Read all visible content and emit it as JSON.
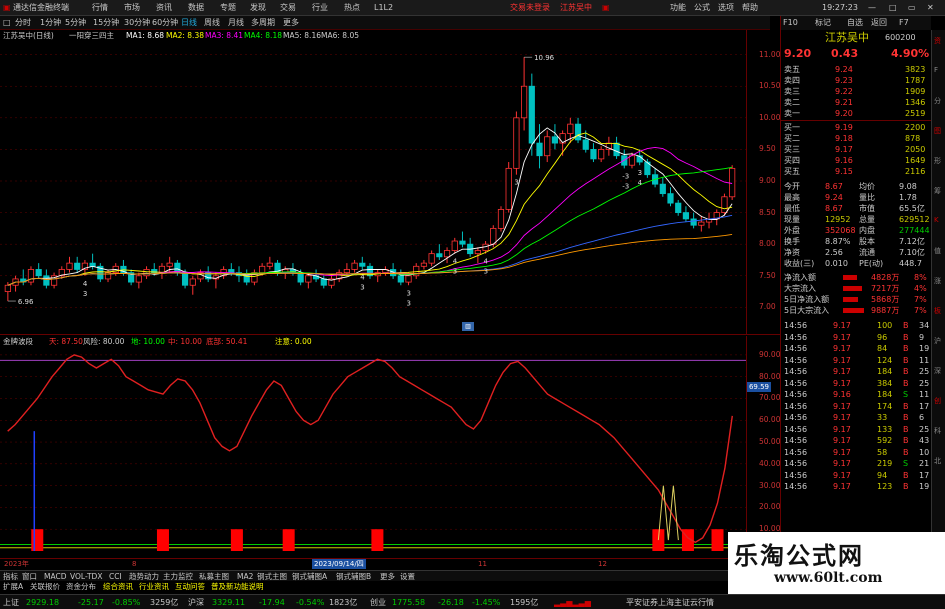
{
  "titlebar": {
    "app_title": "通达信金融终端",
    "menu": [
      "行情",
      "市场",
      "资讯",
      "数据",
      "专题",
      "发现",
      "交易",
      "行业",
      "热点",
      "L1L2"
    ],
    "login_status": "交易未登录",
    "stock_title": "江苏吴中",
    "right": [
      "功能",
      "公式",
      "选项",
      "帮助"
    ],
    "clock": "19:27:23"
  },
  "periods": [
    "分时",
    "1分钟",
    "5分钟",
    "15分钟",
    "30分钟",
    "60分钟",
    "日线",
    "周线",
    "月线",
    "多周期",
    "更多"
  ],
  "mainchart": {
    "stock_label": "江苏吴中(日线)",
    "pattern_label": "一阳穿三四主",
    "ma": [
      "MA1: 8.68",
      "MA2: 8.38",
      "MA3: 8.41",
      "MA4: 8.18",
      "MA5: 8.16",
      "MA6: 8.05"
    ],
    "high_label": "10.96",
    "low_label": "6.96",
    "markers": [
      "4",
      "3",
      "4",
      "3",
      "3",
      "3",
      "4",
      "3",
      "4",
      "3",
      "3",
      "-3",
      "-3",
      "4",
      "3"
    ]
  },
  "axis_main": [
    "11.00",
    "10.50",
    "10.00",
    "9.50",
    "9.00",
    "8.50",
    "8.00",
    "7.50",
    "7.00"
  ],
  "axis_sub": [
    "90.00",
    "80.00",
    "70.00",
    "60.00",
    "50.00",
    "40.00",
    "30.00",
    "20.00",
    "10.00"
  ],
  "subchart": {
    "name": "金牌波段",
    "legend": [
      "天: 87.50",
      "风险: 80.00",
      "地: 10.00",
      "中: 10.00",
      "底部: 50.41",
      "注意: 0.00"
    ],
    "cursor_value": "69.59"
  },
  "dateaxis": [
    "2023年",
    "8",
    "2023/09/14/四",
    "11",
    "12"
  ],
  "tabs": [
    "指标",
    "窗口",
    "MACD",
    "VOL-TDX",
    "CCI",
    "趋势动力",
    "主力监控",
    "私募主图",
    "MA2",
    "钢式主图",
    "钢式辅图A",
    "钢式辅图B",
    "更多",
    "设置"
  ],
  "tabs2": [
    "扩展A",
    "关联报价",
    "资金分布",
    "综合资讯",
    "行业资讯",
    "互动问答",
    "普及新功能说明"
  ],
  "status": {
    "sh": {
      "name": "上证",
      "value": "2929.18",
      "change": "-25.17",
      "pct": "-0.85%",
      "turnover": "3259亿"
    },
    "sz": {
      "name": "沪深",
      "value": "3329.11",
      "change": "-17.94",
      "pct": "-0.54%",
      "turnover": "1823亿"
    },
    "cy": {
      "name": "创业",
      "value": "1775.58",
      "change": "-26.18",
      "pct": "-1.45%",
      "turnover": "1595亿"
    },
    "server": "平安证券上海主证云行情"
  },
  "rp": {
    "toolbar": [
      "F10",
      "标记",
      "自选",
      "返回",
      "F7"
    ],
    "stock_name": "江苏吴中",
    "stock_code": "600200",
    "price": "9.20",
    "change": "0.43",
    "pct": "4.90%",
    "sells": [
      {
        "label": "卖五",
        "price": "9.24",
        "vol": "3823"
      },
      {
        "label": "卖四",
        "price": "9.23",
        "vol": "1787"
      },
      {
        "label": "卖三",
        "price": "9.22",
        "vol": "1909"
      },
      {
        "label": "卖二",
        "price": "9.21",
        "vol": "1346"
      },
      {
        "label": "卖一",
        "price": "9.20",
        "vol": "2519"
      }
    ],
    "buys": [
      {
        "label": "买一",
        "price": "9.19",
        "vol": "2200"
      },
      {
        "label": "买二",
        "price": "9.18",
        "vol": "878"
      },
      {
        "label": "买三",
        "price": "9.17",
        "vol": "2050"
      },
      {
        "label": "买四",
        "price": "9.16",
        "vol": "1649"
      },
      {
        "label": "买五",
        "price": "9.15",
        "vol": "2116"
      }
    ],
    "stats": [
      {
        "l1": "今开",
        "v1": "8.67",
        "l2": "均价",
        "v2": "9.08"
      },
      {
        "l1": "最高",
        "v1": "9.24",
        "l2": "量比",
        "v2": "1.78"
      },
      {
        "l1": "最低",
        "v1": "8.67",
        "l2": "市值",
        "v2": "65.5亿"
      },
      {
        "l1": "现量",
        "v1": "12952",
        "l2": "总量",
        "v2": "629512"
      },
      {
        "l1": "外盘",
        "v1": "352068",
        "l2": "内盘",
        "v2": "277444"
      },
      {
        "l1": "换手",
        "v1": "8.87%",
        "l2": "股本",
        "v2": "7.12亿"
      },
      {
        "l1": "净资",
        "v1": "2.56",
        "l2": "流通",
        "v2": "7.10亿"
      },
      {
        "l1": "收益(三)",
        "v1": "0.010",
        "l2": "PE(动)",
        "v2": "448.7"
      }
    ],
    "flows": [
      {
        "label": "净流入额",
        "value": "4828万",
        "pct": "8%",
        "level": 0.62
      },
      {
        "label": "大宗流入",
        "value": "7217万",
        "pct": "4%",
        "level": 0.88
      },
      {
        "label": "5日净流入额",
        "value": "5868万",
        "pct": "7%",
        "level": 0.7
      },
      {
        "label": "5日大宗流入",
        "value": "9887万",
        "pct": "7%",
        "level": 0.95
      }
    ],
    "ticks": [
      [
        "14:56",
        "9.17",
        "100",
        "B",
        "34"
      ],
      [
        "14:56",
        "9.17",
        "96",
        "B",
        "9"
      ],
      [
        "14:56",
        "9.17",
        "84",
        "B",
        "19"
      ],
      [
        "14:56",
        "9.17",
        "124",
        "B",
        "11"
      ],
      [
        "14:56",
        "9.17",
        "184",
        "B",
        "25"
      ],
      [
        "14:56",
        "9.17",
        "384",
        "B",
        "25"
      ],
      [
        "14:56",
        "9.16",
        "184",
        "S",
        "11"
      ],
      [
        "14:56",
        "9.17",
        "174",
        "B",
        "17"
      ],
      [
        "14:56",
        "9.17",
        "33",
        "B",
        "6"
      ],
      [
        "14:56",
        "9.17",
        "133",
        "B",
        "25"
      ],
      [
        "14:56",
        "9.17",
        "592",
        "B",
        "43"
      ],
      [
        "14:56",
        "9.17",
        "58",
        "B",
        "10"
      ],
      [
        "14:56",
        "9.17",
        "219",
        "S",
        "21"
      ],
      [
        "14:56",
        "9.17",
        "94",
        "B",
        "17"
      ],
      [
        "14:56",
        "9.17",
        "123",
        "B",
        "19"
      ]
    ]
  },
  "sidebar": [
    "资",
    "F",
    "分",
    "图",
    "形",
    "筹",
    "K",
    "值",
    "涨",
    "板",
    "沪",
    "深",
    "创",
    "科",
    "北"
  ],
  "watermark": {
    "title": "乐淘公式网",
    "url": "www.60lt.com"
  },
  "colors": {
    "up": "#ff3333",
    "down": "#00c0c0",
    "ma1": "#ffffff",
    "ma2": "#ffff00",
    "ma3": "#ff00ff",
    "ma4": "#00ff00",
    "ma5": "#3366ff",
    "ma6": "#ff9900",
    "indicator": "#e02020",
    "grid": "#660000"
  },
  "chart_data": [
    {
      "type": "candlestick",
      "ylim": [
        6.8,
        11.2
      ],
      "ylabel": "",
      "xlabel": "",
      "ohlc": [
        [
          7.25,
          7.4,
          7.1,
          7.35
        ],
        [
          7.35,
          7.5,
          7.25,
          7.45
        ],
        [
          7.45,
          7.6,
          7.35,
          7.4
        ],
        [
          7.4,
          7.65,
          7.35,
          7.6
        ],
        [
          7.6,
          7.7,
          7.45,
          7.5
        ],
        [
          7.5,
          7.6,
          7.3,
          7.35
        ],
        [
          7.35,
          7.55,
          7.3,
          7.5
        ],
        [
          7.5,
          7.65,
          7.45,
          7.6
        ],
        [
          7.6,
          7.8,
          7.55,
          7.7
        ],
        [
          7.7,
          7.8,
          7.55,
          7.6
        ],
        [
          7.6,
          7.75,
          7.5,
          7.7
        ],
        [
          7.7,
          7.85,
          7.6,
          7.65
        ],
        [
          7.65,
          7.7,
          7.4,
          7.45
        ],
        [
          7.45,
          7.6,
          7.4,
          7.55
        ],
        [
          7.55,
          7.7,
          7.5,
          7.65
        ],
        [
          7.65,
          7.75,
          7.5,
          7.55
        ],
        [
          7.55,
          7.6,
          7.35,
          7.4
        ],
        [
          7.4,
          7.55,
          7.3,
          7.5
        ],
        [
          7.5,
          7.65,
          7.45,
          7.6
        ],
        [
          7.6,
          7.7,
          7.5,
          7.55
        ],
        [
          7.55,
          7.7,
          7.45,
          7.65
        ],
        [
          7.65,
          7.8,
          7.55,
          7.7
        ],
        [
          7.7,
          7.75,
          7.5,
          7.55
        ],
        [
          7.55,
          7.6,
          7.3,
          7.35
        ],
        [
          7.35,
          7.5,
          7.2,
          7.45
        ],
        [
          7.45,
          7.6,
          7.4,
          7.55
        ],
        [
          7.55,
          7.65,
          7.4,
          7.45
        ],
        [
          7.45,
          7.55,
          7.3,
          7.5
        ],
        [
          7.5,
          7.65,
          7.45,
          7.6
        ],
        [
          7.6,
          7.7,
          7.5,
          7.55
        ],
        [
          7.55,
          7.65,
          7.4,
          7.5
        ],
        [
          7.5,
          7.6,
          7.35,
          7.4
        ],
        [
          7.4,
          7.6,
          7.35,
          7.55
        ],
        [
          7.55,
          7.7,
          7.5,
          7.65
        ],
        [
          7.65,
          7.8,
          7.6,
          7.7
        ],
        [
          7.7,
          7.75,
          7.5,
          7.55
        ],
        [
          7.55,
          7.65,
          7.45,
          7.6
        ],
        [
          7.6,
          7.7,
          7.5,
          7.55
        ],
        [
          7.55,
          7.6,
          7.35,
          7.4
        ],
        [
          7.4,
          7.55,
          7.3,
          7.5
        ],
        [
          7.5,
          7.6,
          7.4,
          7.45
        ],
        [
          7.45,
          7.5,
          7.3,
          7.35
        ],
        [
          7.35,
          7.5,
          7.3,
          7.45
        ],
        [
          7.45,
          7.6,
          7.4,
          7.55
        ],
        [
          7.55,
          7.7,
          7.5,
          7.6
        ],
        [
          7.6,
          7.75,
          7.55,
          7.7
        ],
        [
          7.7,
          7.8,
          7.6,
          7.65
        ],
        [
          7.65,
          7.7,
          7.45,
          7.5
        ],
        [
          7.5,
          7.6,
          7.4,
          7.55
        ],
        [
          7.55,
          7.65,
          7.5,
          7.6
        ],
        [
          7.6,
          7.7,
          7.45,
          7.5
        ],
        [
          7.5,
          7.6,
          7.35,
          7.4
        ],
        [
          7.4,
          7.55,
          7.35,
          7.5
        ],
        [
          7.5,
          7.7,
          7.45,
          7.65
        ],
        [
          7.65,
          7.75,
          7.6,
          7.7
        ],
        [
          7.7,
          7.9,
          7.65,
          7.85
        ],
        [
          7.85,
          8.0,
          7.75,
          7.8
        ],
        [
          7.8,
          7.95,
          7.7,
          7.9
        ],
        [
          7.9,
          8.1,
          7.85,
          8.05
        ],
        [
          8.05,
          8.2,
          7.95,
          8.0
        ],
        [
          8.0,
          8.1,
          7.8,
          7.85
        ],
        [
          7.85,
          7.95,
          7.7,
          7.9
        ],
        [
          7.9,
          8.05,
          7.85,
          8.0
        ],
        [
          8.0,
          8.3,
          7.95,
          8.25
        ],
        [
          8.25,
          8.6,
          8.2,
          8.55
        ],
        [
          8.55,
          9.3,
          8.5,
          9.2
        ],
        [
          9.2,
          10.1,
          9.1,
          10.0
        ],
        [
          10.0,
          10.96,
          9.8,
          10.5
        ],
        [
          10.5,
          10.7,
          9.4,
          9.6
        ],
        [
          9.6,
          9.9,
          9.2,
          9.4
        ],
        [
          9.4,
          9.8,
          9.3,
          9.7
        ],
        [
          9.7,
          9.9,
          9.5,
          9.6
        ],
        [
          9.6,
          9.8,
          9.4,
          9.75
        ],
        [
          9.75,
          10.0,
          9.6,
          9.9
        ],
        [
          9.9,
          10.0,
          9.6,
          9.65
        ],
        [
          9.65,
          9.8,
          9.45,
          9.5
        ],
        [
          9.5,
          9.6,
          9.3,
          9.35
        ],
        [
          9.35,
          9.55,
          9.3,
          9.5
        ],
        [
          9.5,
          9.7,
          9.4,
          9.6
        ],
        [
          9.6,
          9.7,
          9.35,
          9.4
        ],
        [
          9.4,
          9.5,
          9.2,
          9.25
        ],
        [
          9.25,
          9.45,
          9.2,
          9.4
        ],
        [
          9.4,
          9.5,
          9.25,
          9.3
        ],
        [
          9.3,
          9.35,
          9.05,
          9.1
        ],
        [
          9.1,
          9.2,
          8.9,
          8.95
        ],
        [
          8.95,
          9.05,
          8.75,
          8.8
        ],
        [
          8.8,
          8.9,
          8.6,
          8.65
        ],
        [
          8.65,
          8.7,
          8.45,
          8.5
        ],
        [
          8.5,
          8.6,
          8.35,
          8.4
        ],
        [
          8.4,
          8.5,
          8.25,
          8.3
        ],
        [
          8.3,
          8.45,
          8.2,
          8.35
        ],
        [
          8.35,
          8.5,
          8.25,
          8.4
        ],
        [
          8.4,
          8.55,
          8.3,
          8.5
        ],
        [
          8.5,
          8.8,
          8.45,
          8.75
        ],
        [
          8.75,
          9.25,
          8.7,
          9.2
        ]
      ]
    },
    {
      "type": "line",
      "ylim": [
        0,
        95
      ],
      "ylabel": "",
      "xlabel": "",
      "series": [
        {
          "values": [
            55,
            58,
            62,
            66,
            70,
            75,
            80,
            84,
            88,
            90,
            89,
            86,
            84,
            86,
            88,
            85,
            80,
            78,
            76,
            74,
            73,
            72,
            76,
            79,
            78,
            74,
            68,
            60,
            52,
            48,
            46,
            48,
            55,
            62,
            68,
            74,
            78,
            76,
            70,
            64,
            60,
            58,
            60,
            66,
            72,
            76,
            80,
            82,
            84,
            86,
            88,
            87,
            84,
            80,
            78,
            76,
            74,
            72,
            70,
            68,
            66,
            62,
            58,
            56,
            60,
            68,
            76,
            82,
            86,
            87,
            84,
            80,
            76,
            72,
            70,
            68,
            66,
            64,
            62,
            60,
            58,
            55,
            52,
            48,
            44,
            40,
            36,
            32,
            28,
            22,
            16,
            10,
            6,
            4,
            6,
            12,
            22,
            38,
            62
          ]
        },
        {
          "values": [
            0,
            0,
            0,
            0,
            0,
            0,
            0,
            0,
            0,
            0,
            0,
            0,
            0,
            0,
            0,
            0,
            0,
            0,
            0,
            0,
            0,
            0,
            0,
            0,
            0,
            0,
            0,
            0,
            0,
            0,
            0,
            0,
            0,
            0,
            0,
            0,
            0,
            0,
            0,
            0,
            0,
            0,
            0,
            0,
            0,
            0,
            0,
            0,
            0,
            0,
            0,
            0,
            0,
            0,
            0,
            0,
            0,
            0,
            0,
            0,
            0,
            0,
            0,
            0,
            0,
            0,
            0,
            0,
            0,
            0,
            0,
            0,
            0,
            0,
            0,
            0,
            0,
            0,
            0,
            0,
            0,
            0,
            0,
            0,
            0,
            0,
            0,
            0,
            0,
            0,
            0,
            0,
            0,
            0,
            0,
            0,
            0,
            0,
            0
          ]
        },
        {
          "values": [
            10,
            10,
            10,
            10,
            10,
            10,
            10,
            10,
            10,
            10,
            10,
            10,
            10,
            10,
            10,
            10,
            10,
            10,
            10,
            10,
            10,
            10,
            10,
            10,
            10,
            10,
            10,
            10,
            10,
            10,
            10,
            10,
            10,
            10,
            10,
            10,
            10,
            10,
            10,
            10,
            10,
            10,
            10,
            10,
            10,
            10,
            10,
            10,
            10,
            10,
            10,
            10,
            10,
            10,
            10,
            10,
            10,
            10,
            10,
            10,
            10,
            10,
            10,
            10,
            10,
            10,
            10,
            10,
            10,
            10,
            10,
            10,
            10,
            10,
            10,
            10,
            10,
            10,
            10,
            10,
            10,
            10,
            10,
            10,
            10,
            10,
            10,
            10,
            10,
            10,
            10,
            10,
            10,
            10,
            10,
            10,
            10,
            10,
            10
          ]
        }
      ],
      "spikes": [
        {
          "x": 88,
          "values": [
            30,
            5,
            30,
            5
          ]
        }
      ],
      "signal_bars": [
        4,
        21,
        31,
        38,
        50,
        88,
        92,
        96
      ]
    }
  ]
}
